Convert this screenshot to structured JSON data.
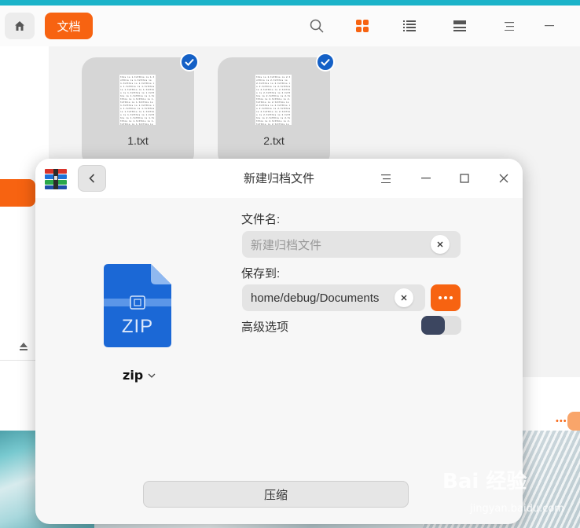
{
  "file_manager": {
    "breadcrumb_label": "文档",
    "toolbar_icons": [
      "home-icon",
      "search-icon",
      "grid-view-icon",
      "list-view-icon",
      "details-view-icon",
      "menu-icon",
      "minimize-icon"
    ],
    "files": [
      {
        "name": "1.txt",
        "selected": true,
        "preview_text": "this is 1.txtthis is 1.txtthis is 1.txtthis is 1.txtthis is 1.txtthis is 1.txtthis is 1.txtthis is 1.txtthis is 1.txtthis is 1.txtthis is 1.txtthis is 1.txtthis is 1.txtthis is 1.txtthis is 1.txtthis is 1.txtthis is 1.txtthis is 1.txtthis is 1.txtthis is 1.txtthis is 1.txtthis is 1.txtthis is 1.txtthis is 1.txtthis is 1.txtthis is 1.txtthis is 1.txtthis is 1.txtthis is 1.txtthis is 1.txtthis is 1.txtthis is 1.txtthis is 1.txtthis is 1.txtthis is 1.txtthis is 1.txtthis is 1.txtthis is 1.txtthis is 1.txtthis is 1.txtthis is 1.txtthis is 1.txtthis is 1.txtthis is 1.txtthis is 1.txtthis is 1.txtthis is 1.txt"
      },
      {
        "name": "2.txt",
        "selected": true,
        "preview_text": "this is 2.txtthis is 2.txtthis is 2.txtthis is 2.txtthis is 2.txtthis is 2.txtthis is 2.txtthis is 2.txtthis is 2.txtthis is 2.txtthis is 2.txtthis is 2.txtthis is 2.txtthis is 2.txtthis is 2.txtthis is 2.txtthis is 2.txtthis is 2.txtthis is 2.txtthis is 2.txtthis is 2.txtthis is 2.txtthis is 2.txtthis is 2.txtthis is 2.txtthis is 2.txtthis is 2.txtthis is 2.txtthis is 2.txtthis is 2.txtthis is 2.txtthis is 2.txtthis is 2.txtthis is 2.txtthis is 2.txtthis is 2.txtthis is 2.txtthis is 2.txtthis is 2.txtthis is 2.txtthis is 2.txtthis is 2.txtthis is 2.txtthis is 2.txtthis is 2.txtthis is 2.txt"
      }
    ],
    "accent_color": "#f76311"
  },
  "dialog": {
    "title": "新建归档文件",
    "icon_label": "ZIP",
    "format_label": "zip",
    "filename_label": "文件名:",
    "filename_placeholder": "新建归档文件",
    "filename_value": "",
    "save_to_label": "保存到:",
    "save_to_value": "home/debug/Documents",
    "advanced_label": "高级选项",
    "advanced_enabled": false,
    "compress_button": "压缩",
    "icons": [
      "archive-app-icon",
      "back-arrow-icon",
      "menu-icon",
      "minimize-icon",
      "maximize-icon",
      "close-icon",
      "clear-icon",
      "more-icon",
      "chevron-down-icon"
    ]
  },
  "watermark": {
    "text": "Bai 经验",
    "sub": "jingyan.baidu.com"
  }
}
